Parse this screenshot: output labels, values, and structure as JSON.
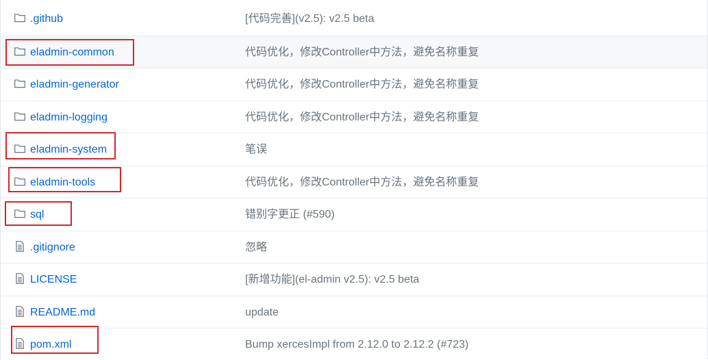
{
  "rows": [
    {
      "type": "dir",
      "name": ".github",
      "message": "[代码完善](v2.5): v2.5 beta"
    },
    {
      "type": "dir",
      "name": "eladmin-common",
      "message": "代码优化，修改Controller中方法，避免名称重复"
    },
    {
      "type": "dir",
      "name": "eladmin-generator",
      "message": "代码优化，修改Controller中方法，避免名称重复"
    },
    {
      "type": "dir",
      "name": "eladmin-logging",
      "message": "代码优化，修改Controller中方法，避免名称重复"
    },
    {
      "type": "dir",
      "name": "eladmin-system",
      "message": "笔误"
    },
    {
      "type": "dir",
      "name": "eladmin-tools",
      "message": "代码优化，修改Controller中方法，避免名称重复"
    },
    {
      "type": "dir",
      "name": "sql",
      "message": "错别字更正 (#590)"
    },
    {
      "type": "file",
      "name": ".gitignore",
      "message": "忽略"
    },
    {
      "type": "file",
      "name": "LICENSE",
      "message": "[新增功能](el-admin v2.5): v2.5 beta"
    },
    {
      "type": "file",
      "name": "README.md",
      "message": "update"
    },
    {
      "type": "file",
      "name": "pom.xml",
      "message": "Bump xercesImpl from 2.12.0 to 2.12.2 (#723)"
    }
  ],
  "colors": {
    "link": "#0366d6",
    "message": "#6a737d",
    "icon": "#6a737d",
    "highlight": "#d0282c",
    "alt_row": "#f6f8fa"
  },
  "icons": {
    "dir": "folder-icon",
    "file": "file-text-icon"
  }
}
